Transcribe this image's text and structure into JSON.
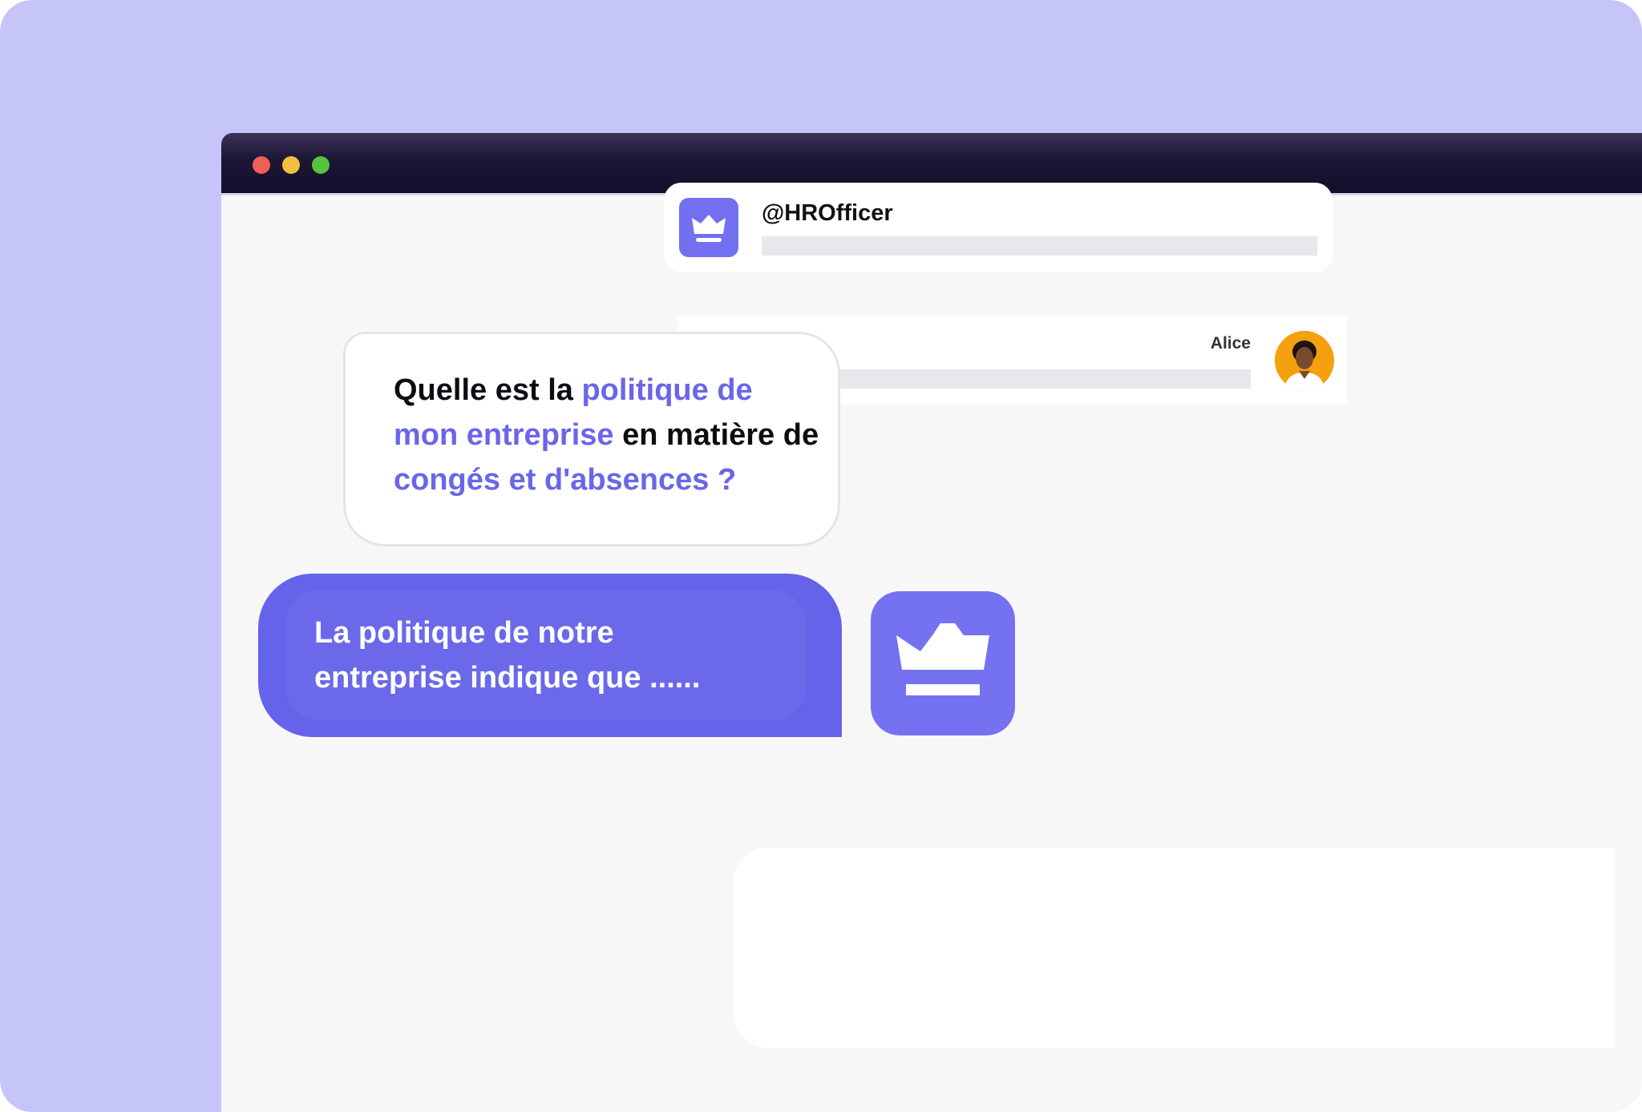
{
  "window": {
    "traffic_lights": {
      "red": "#ed5f57",
      "yellow": "#f4be3f",
      "green": "#58c43d"
    }
  },
  "hr_card": {
    "handle": "@HROfficer",
    "icon": "crown-icon"
  },
  "alice_card": {
    "name": "Alice",
    "avatar": "user-avatar"
  },
  "question": {
    "part1": "Quelle est la ",
    "highlight1": "politique de mon entreprise",
    "part2": " en matière de ",
    "highlight2": "congés et d'absences ?"
  },
  "answer": {
    "text": "La politique de notre entreprise indique que ......"
  },
  "crown_tile": {
    "icon": "crown-icon"
  },
  "colors": {
    "accent": "#6a66e8",
    "backdrop": "#c6c5f9",
    "answer_bubble": "#6563ea"
  }
}
